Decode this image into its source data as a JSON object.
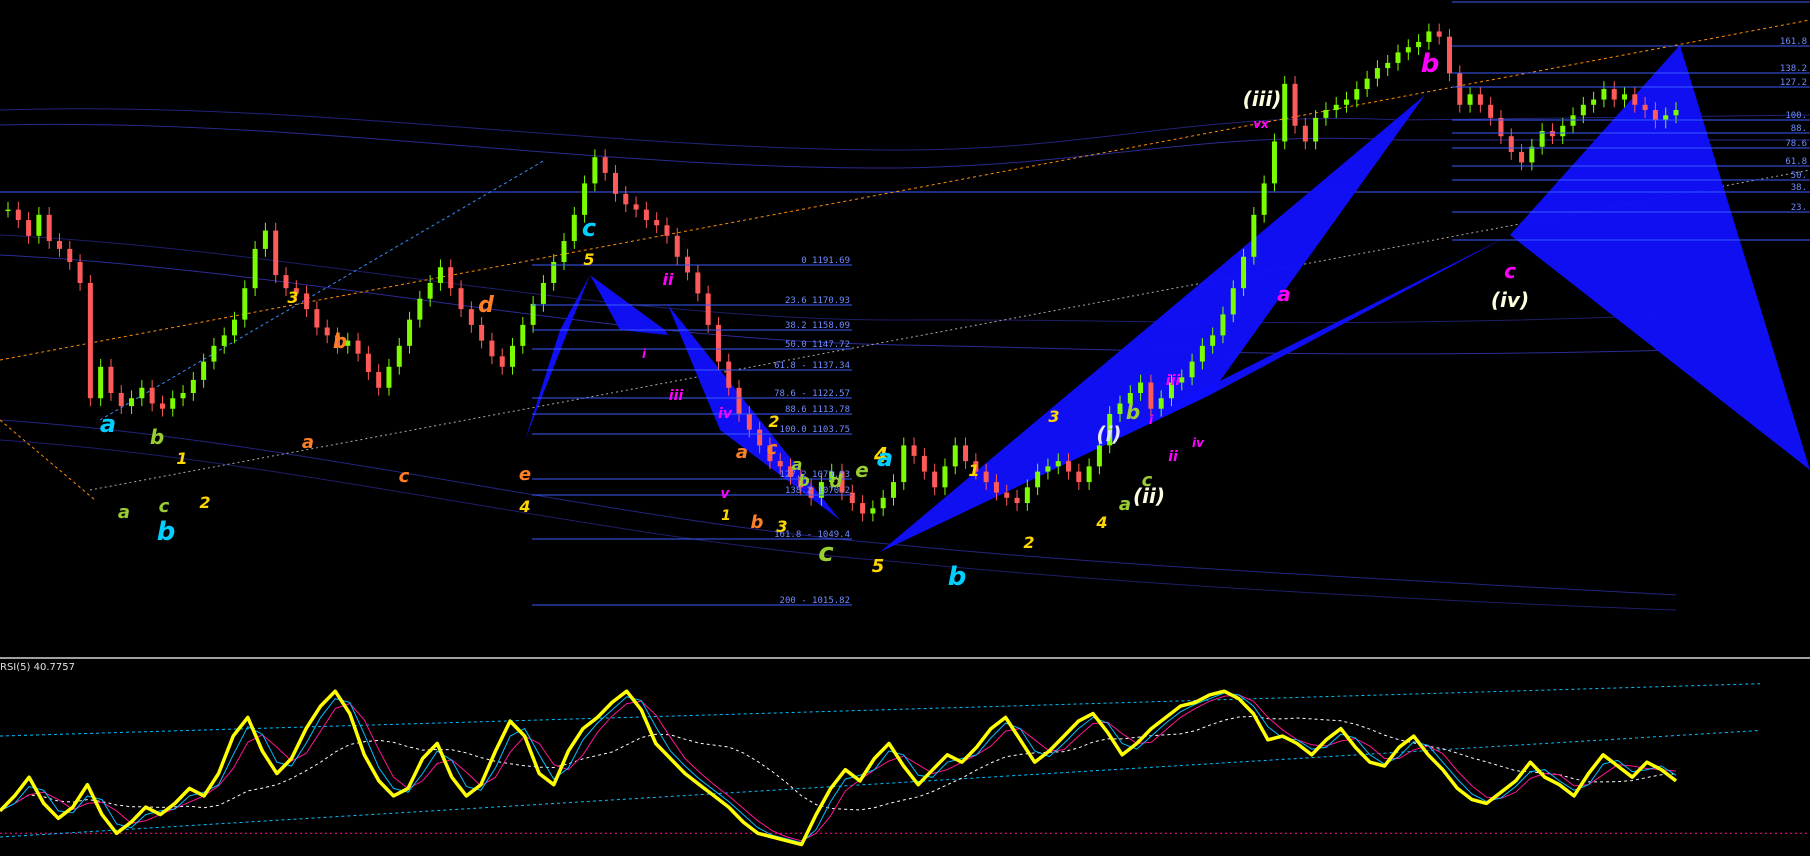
{
  "indicator": {
    "label": "RSI(5) 40.7757"
  },
  "colors": {
    "background": "#000000",
    "bull": "#7CFC00",
    "bear": "#FF5A5A",
    "pattern_fill": "#1010FF",
    "fib_line": "#3A5AFF",
    "fib_text": "#6F8CFF",
    "rsi_main": "#FFFF00",
    "rsi_ma1": "#00BFFF",
    "rsi_ma2": "#FF1493",
    "trend_orange": "#FF8C00",
    "trend_blue": "#3A8CFF"
  },
  "fib_left": {
    "levels": [
      {
        "text": "0 1191.69",
        "price": 1191.69
      },
      {
        "text": "23.6 1170.93",
        "price": 1170.93
      },
      {
        "text": "38.2 1158.09",
        "price": 1158.09
      },
      {
        "text": "50.0 1147.72",
        "price": 1147.72
      },
      {
        "text": "61.8 - 1137.34",
        "price": 1137.34
      },
      {
        "text": "78.6 - 1122.57",
        "price": 1122.57
      },
      {
        "text": "88.6 1113.78",
        "price": 1113.78
      },
      {
        "text": "100.0 1103.75",
        "price": 1103.75
      },
      {
        "text": "127.2 1079.83",
        "price": 1079.83
      },
      {
        "text": "138.2 1070.2",
        "price": 1070.2
      },
      {
        "text": "161.8 - 1049.4",
        "price": 1049.4
      },
      {
        "text": "200 - 1015.82",
        "price": 1015.82
      }
    ]
  },
  "fib_right": {
    "levels": [
      "161.8",
      "138.2",
      "127.2",
      "100.",
      "88.",
      "78.6",
      "61.8",
      "50.",
      "38.",
      "23."
    ]
  },
  "wave_labels": [
    {
      "text": "a",
      "color": "#00CFFF"
    },
    {
      "text": "b",
      "color": "#9ACD32"
    },
    {
      "text": "1",
      "color": "#FFD700"
    },
    {
      "text": "a",
      "color": "#9ACD32"
    },
    {
      "text": "c",
      "color": "#9ACD32"
    },
    {
      "text": "b",
      "color": "#00CFFF"
    },
    {
      "text": "2",
      "color": "#FFD700"
    },
    {
      "text": "3",
      "color": "#FFD700"
    },
    {
      "text": "a",
      "color": "#FF7F27"
    },
    {
      "text": "b",
      "color": "#FF7F27"
    },
    {
      "text": "c",
      "color": "#FF7F27"
    },
    {
      "text": "d",
      "color": "#FF7F27"
    },
    {
      "text": "e",
      "color": "#FF7F27"
    },
    {
      "text": "4",
      "color": "#FFD700"
    },
    {
      "text": "c",
      "color": "#00CFFF"
    },
    {
      "text": "5",
      "color": "#FFD700"
    },
    {
      "text": "ii",
      "color": "#FF00FF"
    },
    {
      "text": "i",
      "color": "#FF00FF"
    },
    {
      "text": "iii",
      "color": "#FF00FF"
    },
    {
      "text": "iv",
      "color": "#FF00FF"
    },
    {
      "text": "v",
      "color": "#FF00FF"
    },
    {
      "text": "1",
      "color": "#FFD700"
    },
    {
      "text": "b",
      "color": "#FF7F27"
    },
    {
      "text": "a",
      "color": "#FF7F27"
    },
    {
      "text": "c",
      "color": "#FF7F27"
    },
    {
      "text": "2",
      "color": "#FFD700"
    },
    {
      "text": "3",
      "color": "#FFD700"
    },
    {
      "text": "a",
      "color": "#9ACD32"
    },
    {
      "text": "b",
      "color": "#9ACD32"
    },
    {
      "text": "c",
      "color": "#9ACD32"
    },
    {
      "text": "d",
      "color": "#9ACD32"
    },
    {
      "text": "e",
      "color": "#9ACD32"
    },
    {
      "text": "4",
      "color": "#FFD700"
    },
    {
      "text": "5",
      "color": "#FFD700"
    },
    {
      "text": "a",
      "color": "#00CFFF"
    },
    {
      "text": "b",
      "color": "#00CFFF"
    },
    {
      "text": "1",
      "color": "#FFD700"
    },
    {
      "text": "2",
      "color": "#FFD700"
    },
    {
      "text": "3",
      "color": "#FFD700"
    },
    {
      "text": "(i)",
      "color": "#E6E6FA"
    },
    {
      "text": "4",
      "color": "#FFD700"
    },
    {
      "text": "a",
      "color": "#9ACD32"
    },
    {
      "text": "(ii)",
      "color": "#FFFFE0"
    },
    {
      "text": "b",
      "color": "#9ACD32"
    },
    {
      "text": "c",
      "color": "#9ACD32"
    },
    {
      "text": "i",
      "color": "#FF00FF"
    },
    {
      "text": "ii",
      "color": "#FF00FF"
    },
    {
      "text": "iii",
      "color": "#FF00FF"
    },
    {
      "text": "iv",
      "color": "#FF00FF"
    },
    {
      "text": "(iii)",
      "color": "#FFFFE0"
    },
    {
      "text": "vx",
      "color": "#FF00FF"
    },
    {
      "text": "a",
      "color": "#FF00FF"
    },
    {
      "text": "b",
      "color": "#FF00FF"
    },
    {
      "text": "c",
      "color": "#FF00FF"
    },
    {
      "text": "(iv)",
      "color": "#FFFFE0"
    }
  ],
  "chart_data": [
    {
      "type": "candlestick",
      "title": "",
      "xlabel": "",
      "ylabel": "",
      "ylim": [
        1000,
        1250
      ],
      "grid": false,
      "series": [
        {
          "values": [
            1170,
            1166,
            1160,
            1168,
            1158,
            1155,
            1150,
            1142,
            1098,
            1110,
            1100,
            1095,
            1098,
            1102,
            1096,
            1094,
            1098,
            1100,
            1105,
            1112,
            1118,
            1122,
            1128,
            1140,
            1155,
            1162,
            1145,
            1140,
            1138,
            1132,
            1125,
            1122,
            1118,
            1120,
            1115,
            1108,
            1102,
            1110,
            1118,
            1128,
            1136,
            1142,
            1148,
            1140,
            1132,
            1126,
            1120,
            1114,
            1110,
            1118,
            1126,
            1134,
            1142,
            1150,
            1158,
            1168,
            1180,
            1190,
            1184,
            1176,
            1172,
            1170,
            1166,
            1164,
            1160,
            1152,
            1146,
            1138,
            1126,
            1112,
            1102,
            1092,
            1086,
            1080,
            1074,
            1072,
            1068,
            1064,
            1060,
            1066,
            1070,
            1062,
            1058,
            1054,
            1056,
            1060,
            1066,
            1080,
            1076,
            1070,
            1064,
            1072,
            1080,
            1074,
            1070,
            1066,
            1062,
            1060,
            1058,
            1064,
            1070,
            1072,
            1074,
            1070,
            1066,
            1072,
            1080,
            1092,
            1096,
            1100,
            1104,
            1094,
            1098,
            1104,
            1106,
            1112,
            1118,
            1122,
            1130,
            1140,
            1152,
            1168,
            1180,
            1196,
            1218,
            1202,
            1196,
            1205,
            1208,
            1210,
            1212,
            1216,
            1220,
            1224,
            1226,
            1230,
            1232,
            1234,
            1238,
            1236,
            1222,
            1210,
            1214,
            1210,
            1205,
            1198,
            1192,
            1188,
            1194,
            1200,
            1198,
            1202,
            1206,
            1210,
            1212,
            1216,
            1212,
            1214,
            1210,
            1208,
            1204,
            1206,
            1208
          ]
        }
      ]
    },
    {
      "type": "line",
      "title": "RSI(5) 40.7757",
      "xlabel": "",
      "ylabel": "",
      "ylim": [
        0,
        100
      ],
      "grid": false,
      "series": [
        {
          "values": [
            22,
            30,
            40,
            26,
            18,
            24,
            36,
            20,
            10,
            16,
            24,
            20,
            26,
            34,
            30,
            42,
            62,
            72,
            54,
            42,
            50,
            66,
            78,
            86,
            74,
            52,
            38,
            30,
            34,
            50,
            58,
            40,
            30,
            36,
            54,
            70,
            62,
            42,
            36,
            54,
            66,
            72,
            80,
            86,
            76,
            58,
            50,
            42,
            36,
            30,
            24,
            16,
            10,
            8,
            6,
            4,
            20,
            34,
            44,
            38,
            50,
            58,
            46,
            36,
            44,
            52,
            48,
            56,
            66,
            72,
            60,
            48,
            54,
            62,
            70,
            74,
            64,
            52,
            58,
            66,
            72,
            78,
            80,
            84,
            86,
            82,
            74,
            60,
            62,
            58,
            52,
            60,
            66,
            56,
            48,
            46,
            56,
            62,
            52,
            44,
            34,
            28,
            26,
            32,
            38,
            48,
            40,
            36,
            30,
            42,
            52,
            46,
            40,
            48,
            44,
            38
          ]
        }
      ]
    }
  ]
}
